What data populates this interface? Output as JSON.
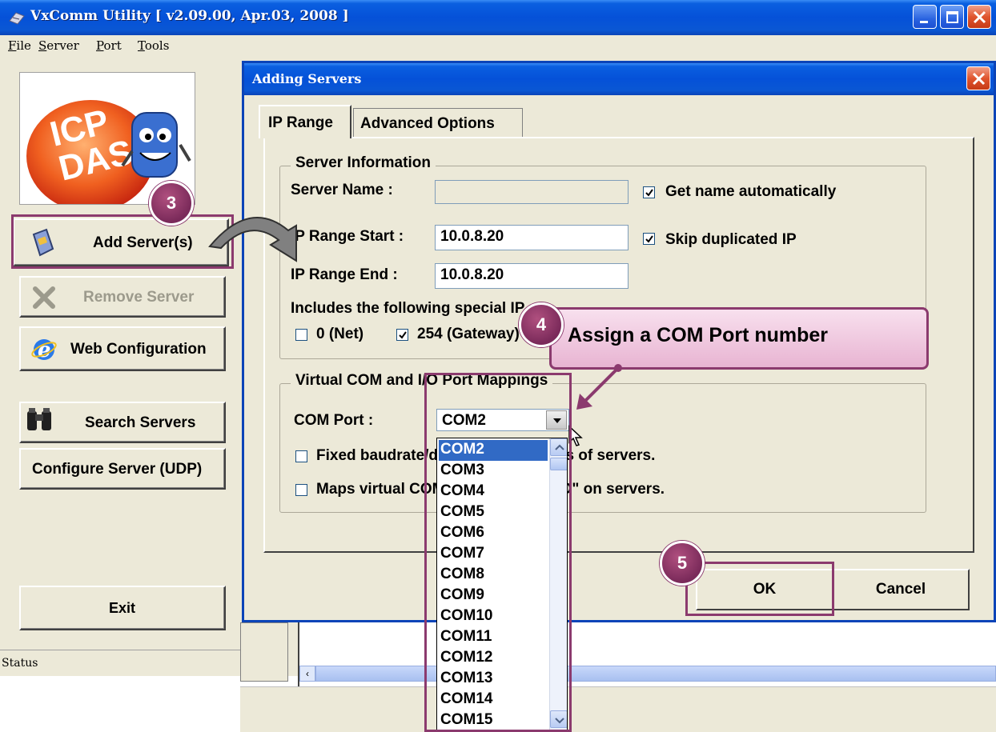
{
  "main_window": {
    "title": "VxComm Utility [ v2.09.00, Apr.03, 2008 ]",
    "menu": [
      "File",
      "Server",
      "Port",
      "Tools"
    ],
    "buttons": {
      "add_server": "Add Server(s)",
      "remove_server": "Remove Server",
      "web_configuration": "Web Configuration",
      "search_servers": "Search Servers",
      "configure_server": "Configure Server (UDP)",
      "exit": "Exit"
    },
    "logo_text": [
      "ICP",
      "DAS"
    ],
    "status_label": "Status"
  },
  "dialog": {
    "title": "Adding Servers",
    "tabs": [
      {
        "label": "IP Range",
        "active": true
      },
      {
        "label": "Advanced Options",
        "active": false
      }
    ],
    "server_info": {
      "group_title": "Server Information",
      "server_name_label": "Server Name :",
      "server_name_value": "",
      "get_name_auto": {
        "label": "Get name automatically",
        "checked": true
      },
      "ip_start_label": "IP Range Start :",
      "ip_start_value": "10.0.8.20",
      "skip_dup": {
        "label": "Skip duplicated IP",
        "checked": true
      },
      "ip_end_label": "IP Range End :",
      "ip_end_value": "10.0.8.20",
      "includes_label": "Includes the following special IP :",
      "net": {
        "label": "0 (Net)",
        "checked": false
      },
      "gateway": {
        "label": "254 (Gateway)",
        "checked": true
      }
    },
    "com_mapping": {
      "group_title": "Virtual COM and I/O Port Mappings",
      "com_port_label": "COM Port :",
      "com_port_value": "COM2",
      "fixed_baudrate": {
        "label": "Fixed baudrate/data format settings of servers.",
        "checked": false
      },
      "maps_virtual": {
        "label": "Maps virtual COM ports to \"Port I/O\" on servers.",
        "checked": false
      },
      "dropdown_options": [
        "COM2",
        "COM3",
        "COM4",
        "COM5",
        "COM6",
        "COM7",
        "COM8",
        "COM9",
        "COM10",
        "COM11",
        "COM12",
        "COM13",
        "COM14",
        "COM15"
      ],
      "dropdown_selected": "COM2"
    },
    "ok_label": "OK",
    "cancel_label": "Cancel"
  },
  "annotations": {
    "step3": "3",
    "step4": "4",
    "step4_text": "Assign a COM Port number",
    "step5": "5",
    "color": "#8b3a6e"
  }
}
